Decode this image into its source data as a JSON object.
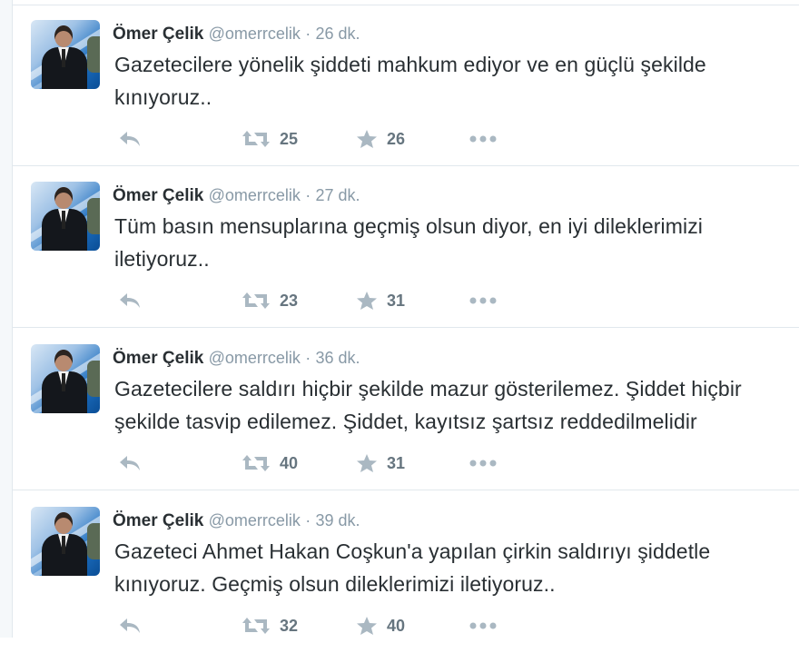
{
  "tweets": [
    {
      "name": "Ömer Çelik",
      "handle": "@omerrcelik",
      "separator": "·",
      "time": "26 dk.",
      "text": "Gazetecilere yönelik şiddeti mahkum ediyor ve en güçlü şekilde kınıyoruz..",
      "retweets": "25",
      "favorites": "26",
      "icons": {
        "reply": "reply-icon",
        "retweet": "retweet-icon",
        "favorite": "star-icon",
        "more": "more-icon"
      }
    },
    {
      "name": "Ömer Çelik",
      "handle": "@omerrcelik",
      "separator": "·",
      "time": "27 dk.",
      "text": "Tüm basın mensuplarına geçmiş olsun diyor, en iyi dileklerimizi iletiyoruz..",
      "retweets": "23",
      "favorites": "31",
      "icons": {
        "reply": "reply-icon",
        "retweet": "retweet-icon",
        "favorite": "star-icon",
        "more": "more-icon"
      }
    },
    {
      "name": "Ömer Çelik",
      "handle": "@omerrcelik",
      "separator": "·",
      "time": "36 dk.",
      "text": "Gazetecilere saldırı hiçbir şekilde mazur gösterilemez. Şiddet hiçbir şekilde tasvip edilemez. Şiddet, kayıtsız şartsız reddedilmelidir",
      "retweets": "40",
      "favorites": "31",
      "icons": {
        "reply": "reply-icon",
        "retweet": "retweet-icon",
        "favorite": "star-icon",
        "more": "more-icon"
      }
    },
    {
      "name": "Ömer Çelik",
      "handle": "@omerrcelik",
      "separator": "·",
      "time": "39 dk.",
      "text": "Gazeteci Ahmet Hakan Coşkun'a yapılan çirkin saldırıyı şiddetle kınıyoruz. Geçmiş olsun dileklerimizi iletiyoruz..",
      "retweets": "32",
      "favorites": "40",
      "icons": {
        "reply": "reply-icon",
        "retweet": "retweet-icon",
        "favorite": "star-icon",
        "more": "more-icon"
      }
    }
  ],
  "colors": {
    "name": "#292f33",
    "meta": "#8899a6",
    "icon": "#aab8c2",
    "count": "#66757f",
    "divider": "#e1e8ed"
  }
}
